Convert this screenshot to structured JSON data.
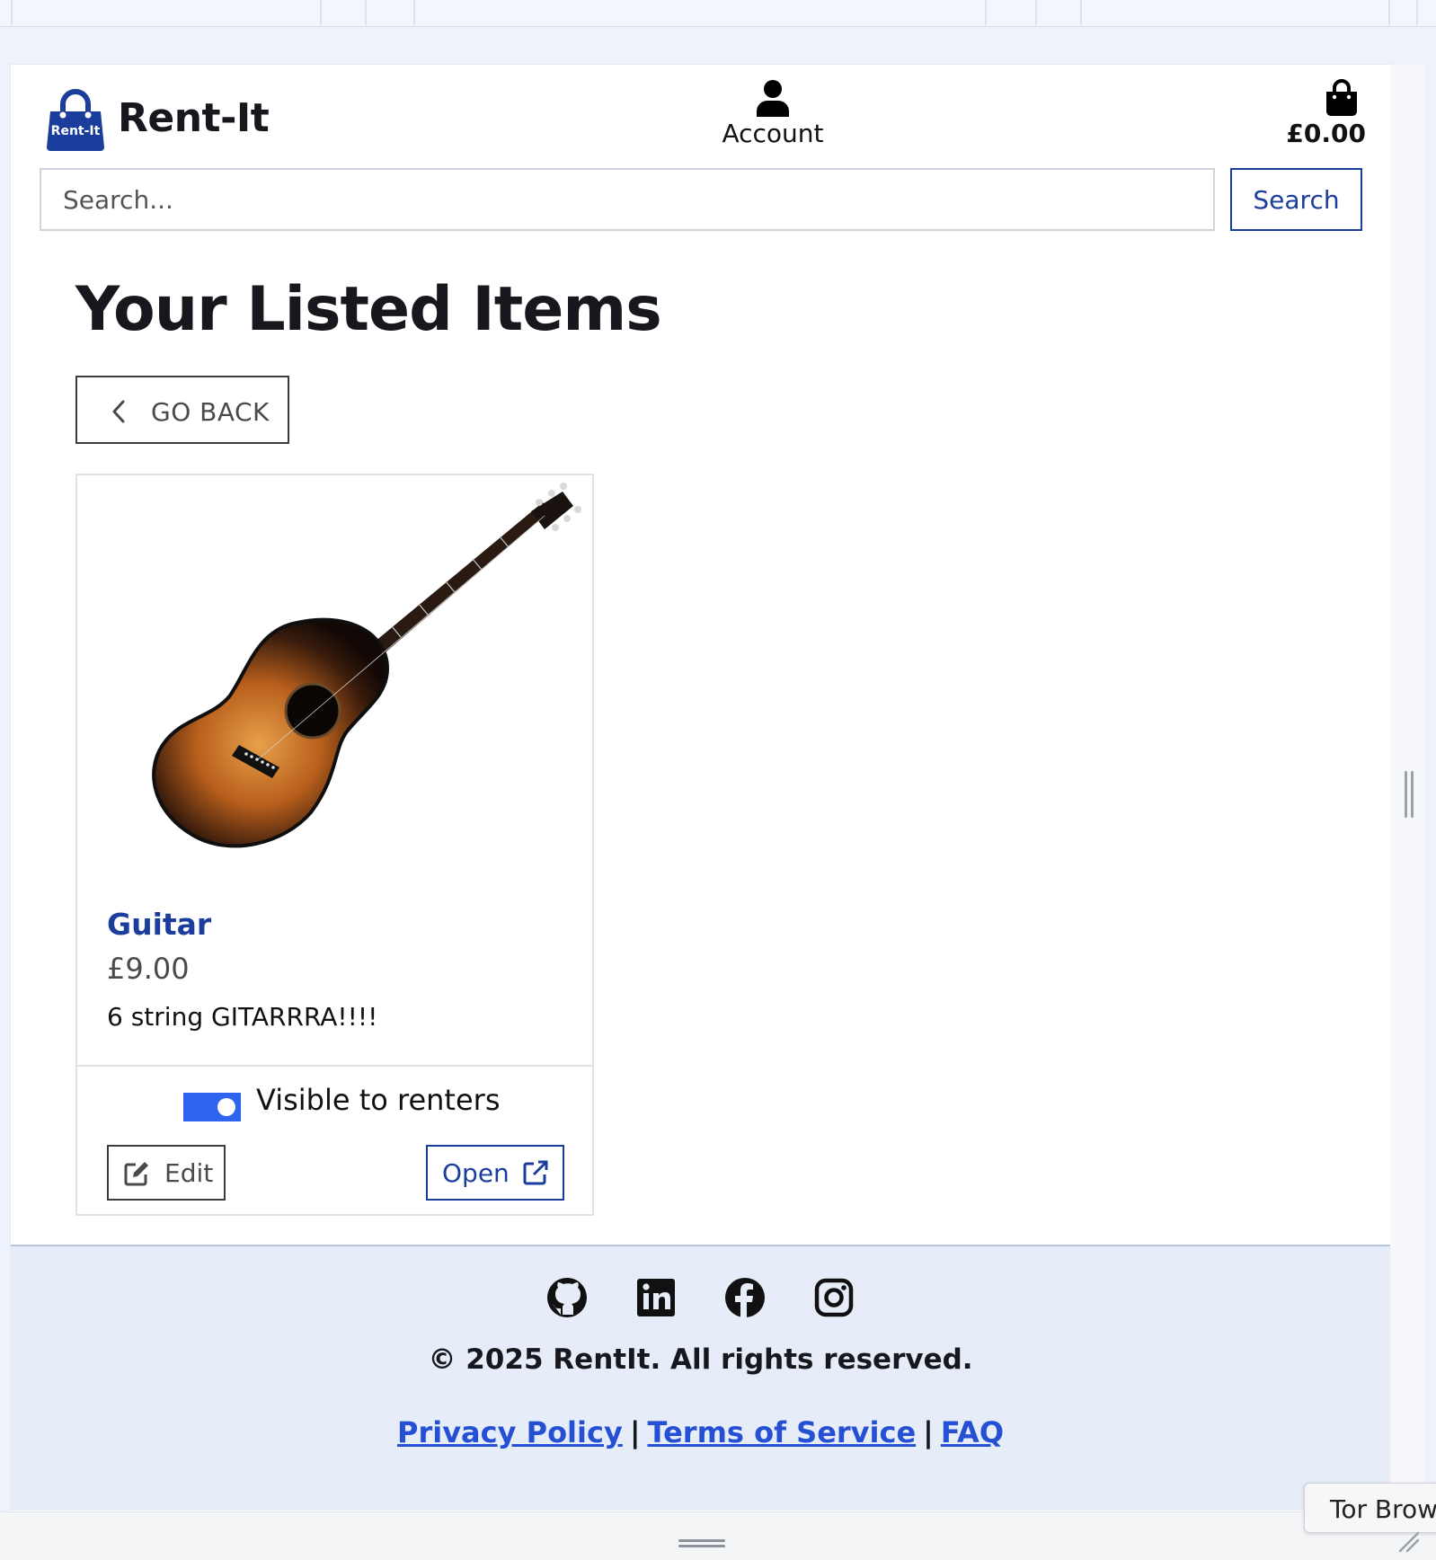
{
  "brand": {
    "name": "Rent-It",
    "logo_text": "Rent-It",
    "color": "#1b3d9c"
  },
  "header": {
    "account_label": "Account",
    "cart_total": "£0.00"
  },
  "search": {
    "placeholder": "Search...",
    "button_label": "Search"
  },
  "page_title": "Your Listed Items",
  "go_back_label": "GO BACK",
  "items": [
    {
      "name": "Guitar",
      "price": "£9.00",
      "description": "6 string GITARRRA!!!!",
      "visibility_label": "Visible to renters",
      "visible": true,
      "edit_label": "Edit",
      "open_label": "Open",
      "image_icon": "acoustic-guitar-image"
    }
  ],
  "footer": {
    "social_icons": [
      "github-icon",
      "linkedin-icon",
      "facebook-icon",
      "instagram-icon"
    ],
    "copyright": "© 2025 RentIt. All rights reserved.",
    "links": {
      "privacy": "Privacy Policy",
      "terms": "Terms of Service",
      "faq": "FAQ",
      "separator": "|"
    }
  },
  "tooltip": "Tor Browser",
  "colors": {
    "accent": "#1b3d9c",
    "toggle_on": "#2f64f0",
    "link": "#2550d4",
    "footer_bg": "#e6edf8"
  }
}
